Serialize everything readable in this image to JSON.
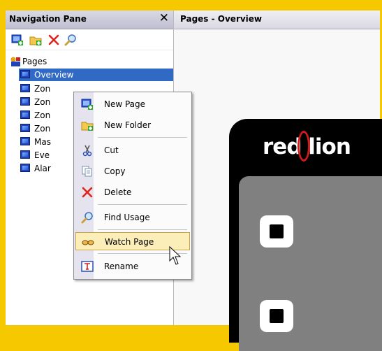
{
  "nav": {
    "title": "Navigation Pane",
    "close_label": "✕",
    "toolbar": [
      {
        "name": "new-page-tool",
        "icon": "new-page-icon"
      },
      {
        "name": "new-folder-tool",
        "icon": "new-folder-icon"
      },
      {
        "name": "delete-tool",
        "icon": "delete-icon"
      },
      {
        "name": "find-tool",
        "icon": "find-icon"
      }
    ],
    "root_label": "Pages",
    "items": [
      {
        "label": "Overview",
        "selected": true
      },
      {
        "label": "Zon"
      },
      {
        "label": "Zon"
      },
      {
        "label": "Zon"
      },
      {
        "label": "Zon"
      },
      {
        "label": "Mas"
      },
      {
        "label": "Eve"
      },
      {
        "label": "Alar"
      }
    ]
  },
  "editor": {
    "title": "Pages - Overview",
    "logo_text": "red lion"
  },
  "context_menu": {
    "items": [
      {
        "label": "New Page",
        "icon": "new-page-icon"
      },
      {
        "label": "New Folder",
        "icon": "new-folder-icon"
      },
      {
        "label": "Cut",
        "icon": "scissors-icon"
      },
      {
        "label": "Copy",
        "icon": "copy-icon"
      },
      {
        "label": "Delete",
        "icon": "delete-icon"
      },
      {
        "label": "Find Usage",
        "icon": "find-icon"
      },
      {
        "label": "Watch Page",
        "icon": "glasses-icon",
        "highlighted": true
      },
      {
        "label": "Rename",
        "icon": "rename-icon"
      }
    ]
  },
  "colors": {
    "selection": "#316ac5",
    "menu_highlight": "#fbeeb8",
    "page_border": "#f6c800",
    "brand_red": "#d11a1a"
  }
}
